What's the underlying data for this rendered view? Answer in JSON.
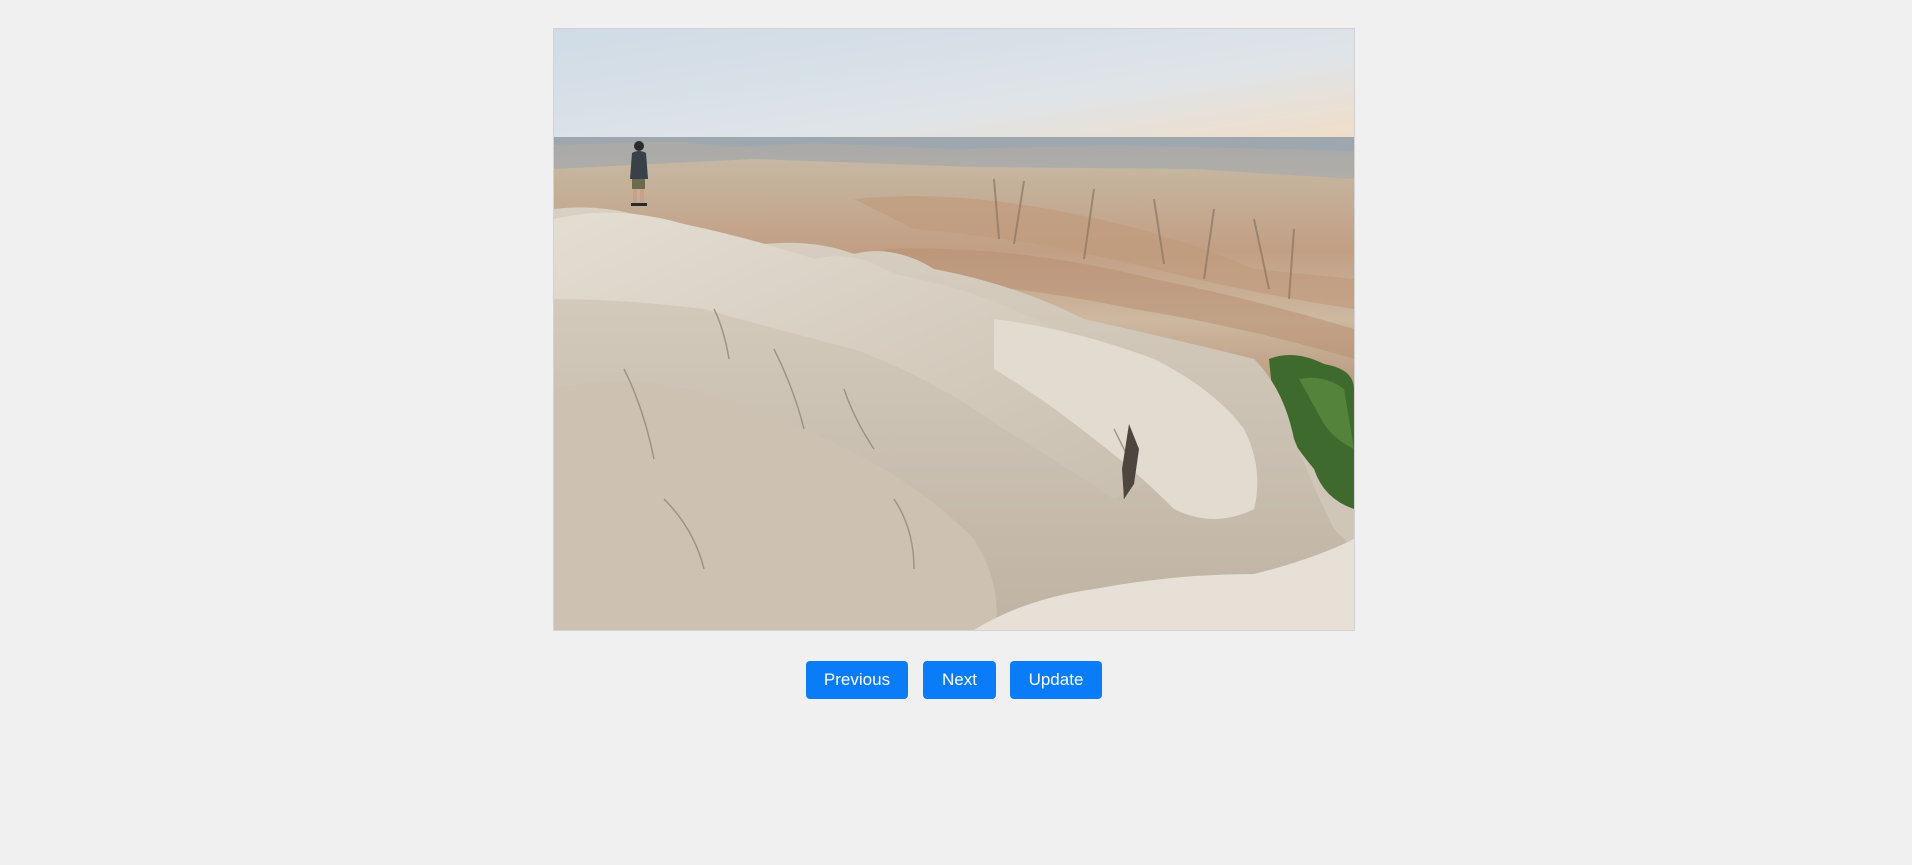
{
  "viewer": {
    "image_subject": "badlands-landscape-photo"
  },
  "controls": {
    "previous_label": "Previous",
    "next_label": "Next",
    "update_label": "Update"
  },
  "colors": {
    "page_background": "#f0f0f0",
    "button_background": "#0a7cf7",
    "button_text": "#ffffff"
  }
}
